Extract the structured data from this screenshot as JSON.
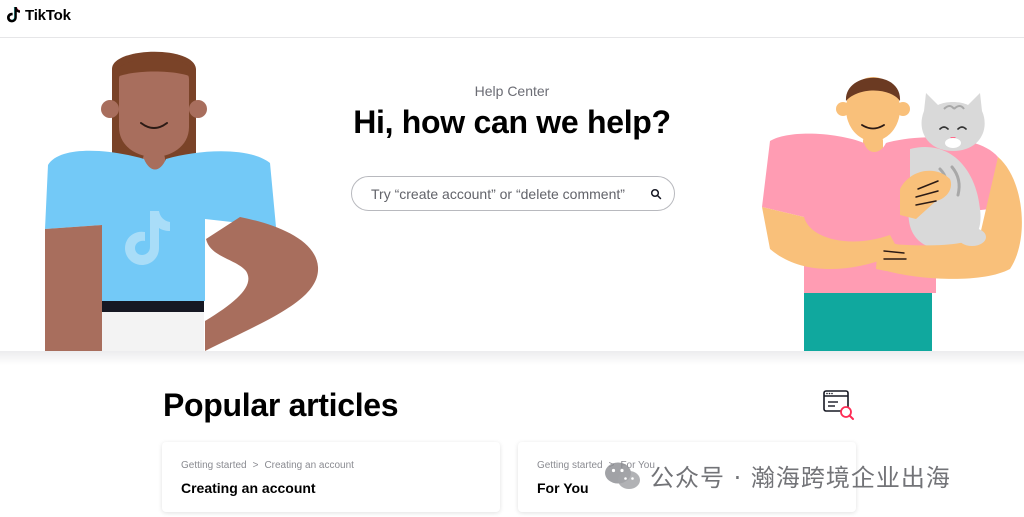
{
  "header": {
    "brand": "TikTok",
    "logo_icon": "tiktok-note-icon"
  },
  "hero": {
    "label": "Help Center",
    "title": "Hi, how can we help?",
    "search_placeholder": "Try “create account” or “delete comment”",
    "search_icon": "search-icon"
  },
  "popular": {
    "title": "Popular articles",
    "icon": "browser-search-icon",
    "articles": [
      {
        "crumb_1": "Getting started",
        "crumb_sep": ">",
        "crumb_2": "Creating an account",
        "title": "Creating an account"
      },
      {
        "crumb_1": "Getting started",
        "crumb_sep": ">",
        "crumb_2": "For You",
        "title": "For You"
      }
    ]
  },
  "watermark": {
    "text": "公众号 · 瀚海跨境企业出海",
    "icon": "wechat-icon"
  },
  "colors": {
    "accent_pink": "#fe2c55",
    "shirt_blue": "#73c9f7",
    "shirt_pink": "#ff9cb3",
    "pants_teal": "#10a89e",
    "skin_dark": "#a86e5d",
    "skin_light": "#f9c07a"
  }
}
